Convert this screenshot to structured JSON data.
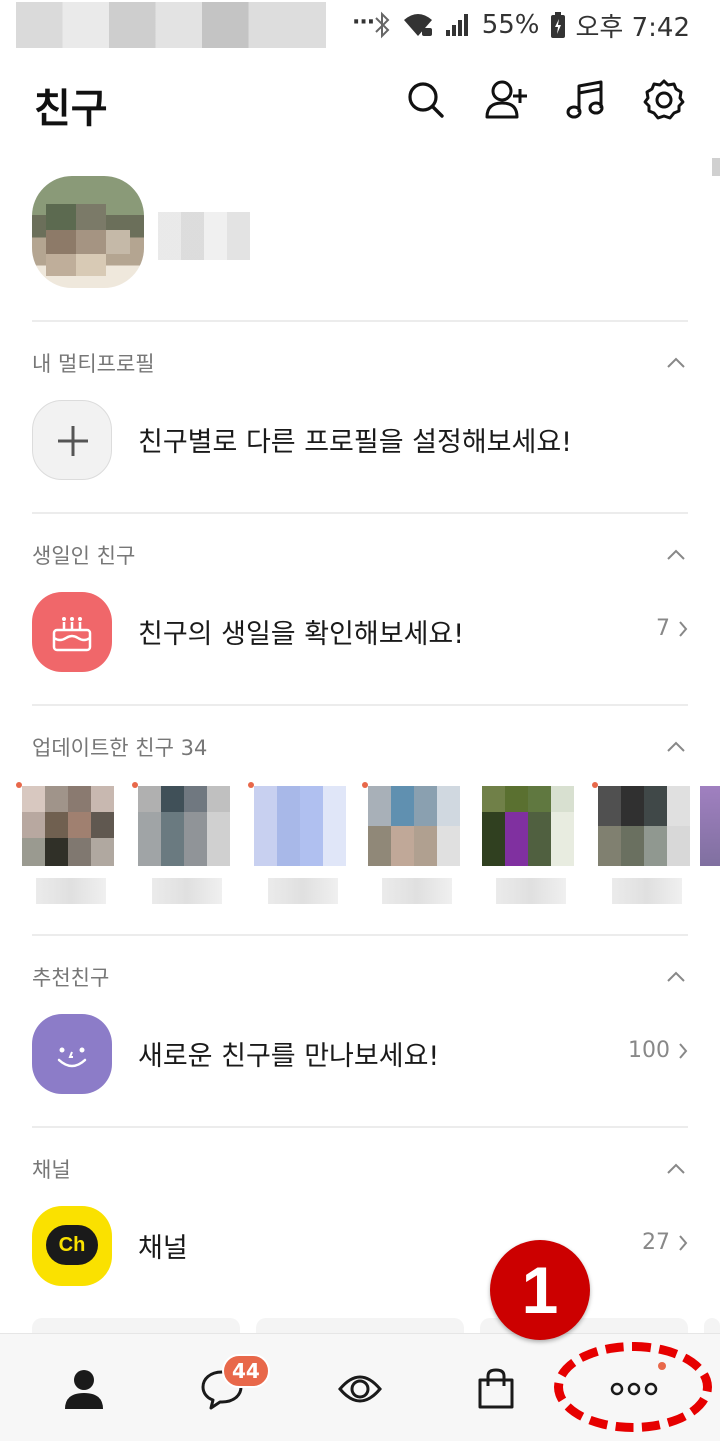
{
  "status_bar": {
    "dots": "···",
    "battery": "55%",
    "time": "오후 7:42"
  },
  "header": {
    "title": "친구",
    "icons": [
      "search-icon",
      "add-friend-icon",
      "music-icon",
      "settings-icon"
    ]
  },
  "sections": {
    "multi_profile": {
      "label": "내 멀티프로필",
      "row_text": "친구별로 다른 프로필을 설정해보세요!"
    },
    "birthday": {
      "label": "생일인 친구",
      "row_text": "친구의 생일을 확인해보세요!",
      "count": "7"
    },
    "updated": {
      "label": "업데이트한 친구",
      "count": "34"
    },
    "recommended": {
      "label": "추천친구",
      "row_text": "새로운 친구를 만나보세요!",
      "count": "100"
    },
    "channel": {
      "label": "채널",
      "row_text": "채널",
      "count": "27",
      "logo_text": "Ch"
    }
  },
  "bottom_nav": {
    "chat_badge": "44",
    "items": [
      "friends-tab-icon",
      "chats-tab-icon",
      "view-tab-icon",
      "shopping-tab-icon",
      "more-tab-icon"
    ]
  },
  "annotation": {
    "marker": "1"
  },
  "colors": {
    "birthday_icon": "#f0676a",
    "recommend_icon": "#8c7cc8",
    "channel_icon": "#fae100",
    "badge": "#e8684a",
    "annotation": "#cc0000"
  }
}
